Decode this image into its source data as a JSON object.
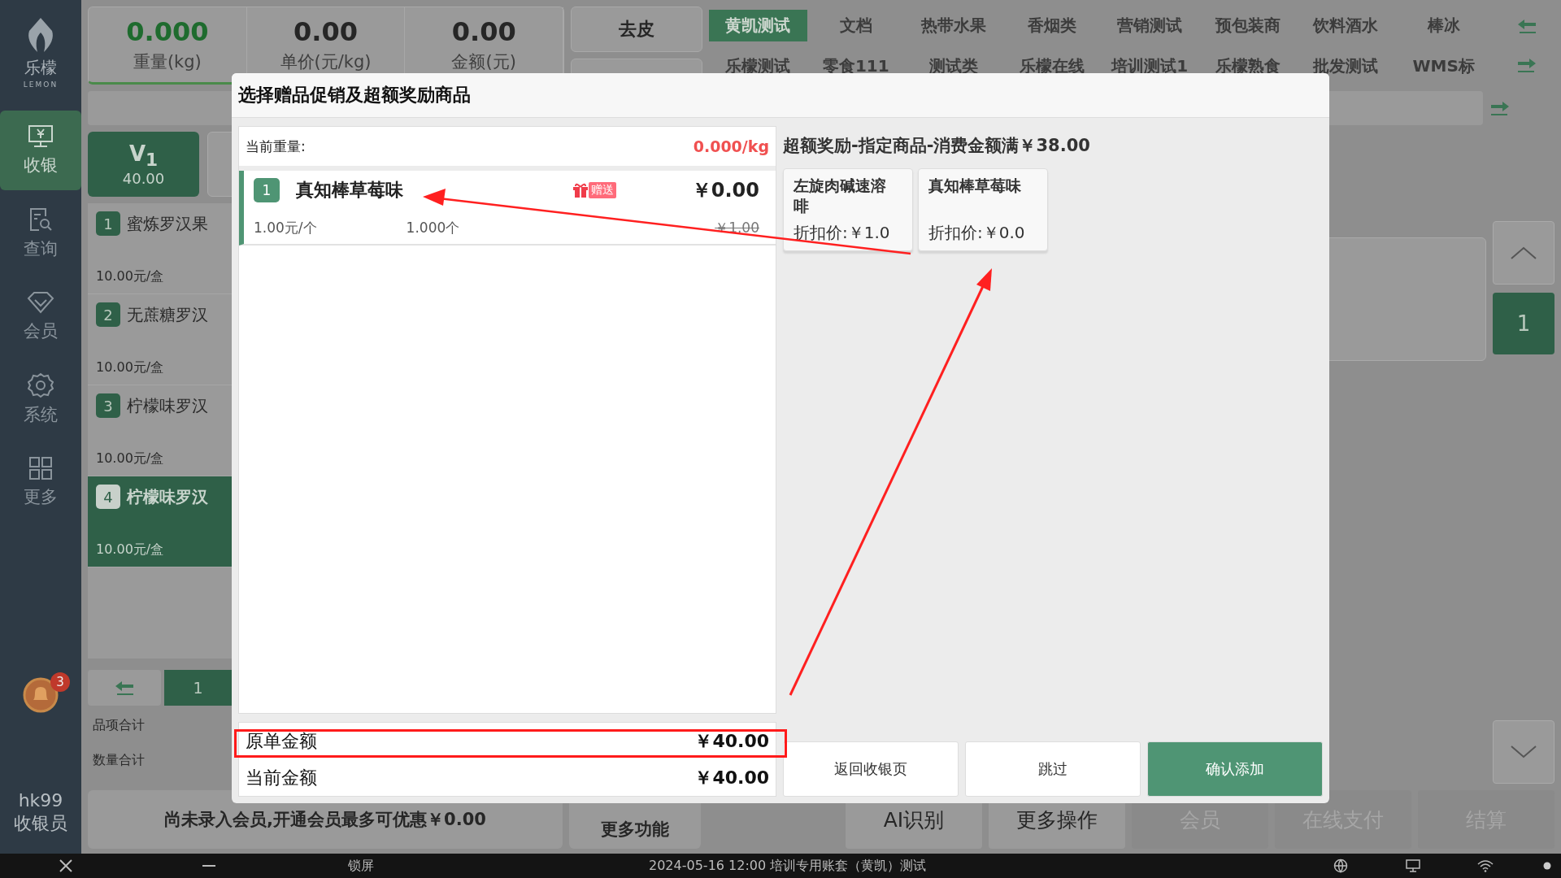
{
  "sidebar": {
    "logo_text": "乐檬",
    "logo_subtext": "LEMON",
    "items": [
      {
        "label": "收银",
        "selected": true,
        "kind": "cashier"
      },
      {
        "label": "查询",
        "selected": false,
        "kind": "query"
      },
      {
        "label": "会员",
        "selected": false,
        "kind": "member"
      },
      {
        "label": "系统",
        "selected": false,
        "kind": "system"
      },
      {
        "label": "更多",
        "selected": false,
        "kind": "more"
      }
    ],
    "notification_count": "3",
    "user": "hk99",
    "role": "收银员"
  },
  "scale": {
    "weight": "0.000",
    "weight_label": "重量(kg)",
    "unit_price": "0.00",
    "unit_price_label": "单价(元/kg)",
    "amount": "0.00",
    "amount_label": "金额(元)",
    "tare_button": "去皮"
  },
  "categories": [
    {
      "label": "黄凯测试",
      "selected": true
    },
    {
      "label": "文档",
      "selected": false
    },
    {
      "label": "热带水果",
      "selected": false
    },
    {
      "label": "香烟类",
      "selected": false
    },
    {
      "label": "营销测试",
      "selected": false
    },
    {
      "label": "预包装商",
      "selected": false
    },
    {
      "label": "饮料酒水",
      "selected": false
    },
    {
      "label": "棒冰",
      "selected": false
    },
    {
      "label": "乐檬测试",
      "selected": false
    },
    {
      "label": "零食111",
      "selected": false
    },
    {
      "label": "测试类",
      "selected": false
    },
    {
      "label": "乐檬在线",
      "selected": false
    },
    {
      "label": "培训测试1",
      "selected": false
    },
    {
      "label": "乐檬熟食",
      "selected": false
    },
    {
      "label": "批发测试",
      "selected": false
    },
    {
      "label": "WMS标",
      "selected": false
    }
  ],
  "order_tab": {
    "title": "V$_{1}$",
    "amount": "40.00"
  },
  "cart_items": [
    {
      "index": "1",
      "name": "蜜炼罗汉果",
      "price": "10.00元/盒",
      "selected": false
    },
    {
      "index": "2",
      "name": "无蔗糖罗汉",
      "price": "10.00元/盒",
      "selected": false
    },
    {
      "index": "3",
      "name": "柠檬味罗汉",
      "price": "10.00元/盒",
      "selected": false
    },
    {
      "index": "4",
      "name": "柠檬味罗汉",
      "price": "10.00元/盒",
      "selected": true
    }
  ],
  "cart_pager": {
    "page": "1"
  },
  "cart_totals": [
    "品项合计",
    "数量合计"
  ],
  "product_pager": {
    "page": "1"
  },
  "footer": {
    "member_notice": "尚未录入会员,开通会员最多可优惠￥0.00",
    "more_functions": "更多功能",
    "actions": [
      {
        "label": "AI识别",
        "disabled": false
      },
      {
        "label": "更多操作",
        "disabled": false
      },
      {
        "label": "会员",
        "disabled": true
      },
      {
        "label": "在线支付",
        "disabled": true
      },
      {
        "label": "结算",
        "disabled": true
      }
    ]
  },
  "taskbar": {
    "lock": "锁屏",
    "status": "2024-05-16 12:00 培训专用账套（黄凯）测试"
  },
  "dialog": {
    "title": "选择赠品促销及超额奖励商品",
    "weight_label": "当前重量:",
    "weight_value": "0.000/kg",
    "items": [
      {
        "index": "1",
        "name": "真知棒草莓味",
        "badge": "赠送",
        "price": "￥0.00",
        "original_price": "￥1.00",
        "unit_price": "1.00元/个",
        "quantity": "1.000个"
      }
    ],
    "original_total_label": "原单金额",
    "original_total": "￥40.00",
    "current_total_label": "当前金额",
    "current_total": "￥40.00",
    "promotion_title": "超额奖励-指定商品-消费金额满￥38.00",
    "reward_products": [
      {
        "name_lines": [
          "左旋肉碱速溶",
          "啡"
        ],
        "price": "折扣价:￥1.0"
      },
      {
        "name_lines": [
          "真知棒草莓味"
        ],
        "price": "折扣价:￥0.0"
      }
    ],
    "buttons": [
      {
        "label": "返回收银页",
        "kind": "default"
      },
      {
        "label": "跳过",
        "kind": "default"
      },
      {
        "label": "确认添加",
        "kind": "primary"
      }
    ]
  }
}
